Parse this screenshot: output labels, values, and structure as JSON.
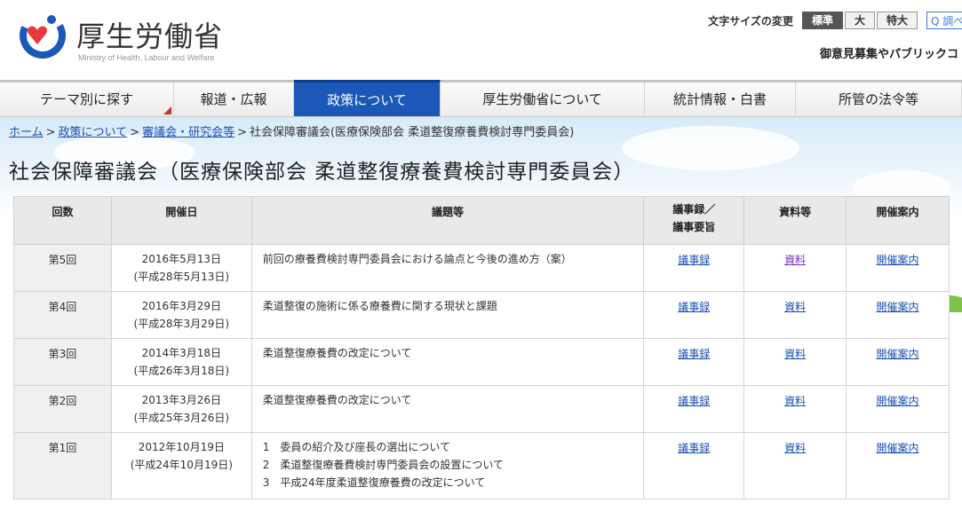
{
  "header": {
    "org_name": "厚生労働省",
    "org_name_en": "Ministry of Health, Labour and Welfare",
    "font_size_label": "文字サイズの変更",
    "font_sizes": [
      "標準",
      "大",
      "特大"
    ],
    "search_text": "Q 調べ",
    "public_comment_link": "御意見募集やパブリックコ"
  },
  "nav": {
    "items": [
      "テーマ別に探す",
      "報道・広報",
      "政策について",
      "厚生労働省について",
      "統計情報・白書",
      "所管の法令等"
    ]
  },
  "breadcrumb": {
    "home": "ホーム",
    "policy": "政策について",
    "councils": "審議会・研究会等",
    "current": "社会保障審議会(医療保険部会 柔道整復療養費検討専門委員会)"
  },
  "page_title": "社会保障審議会（医療保険部会 柔道整復療養費検討専門委員会）",
  "table": {
    "headers": {
      "num": "回数",
      "date": "開催日",
      "topic": "議題等",
      "minutes_1": "議事録／",
      "minutes_2": "議事要旨",
      "materials": "資料等",
      "notice": "開催案内"
    },
    "rows": [
      {
        "num": "第5回",
        "date": "2016年5月13日",
        "date_jp": "(平成28年5月13日)",
        "topics": [
          "前回の療養費検討専門委員会における論点と今後の進め方（案）"
        ],
        "minutes": "議事録",
        "materials": "資料",
        "notice": "開催案内"
      },
      {
        "num": "第4回",
        "date": "2016年3月29日",
        "date_jp": "(平成28年3月29日)",
        "topics": [
          "柔道整復の施術に係る療養費に関する現状と課題"
        ],
        "minutes": "議事録",
        "materials": "資料",
        "notice": "開催案内"
      },
      {
        "num": "第3回",
        "date": "2014年3月18日",
        "date_jp": "(平成26年3月18日)",
        "topics": [
          "柔道整復療養費の改定について"
        ],
        "minutes": "議事録",
        "materials": "資料",
        "notice": "開催案内"
      },
      {
        "num": "第2回",
        "date": "2013年3月26日",
        "date_jp": "(平成25年3月26日)",
        "topics": [
          "柔道整復療養費の改定について"
        ],
        "minutes": "議事録",
        "materials": "資料",
        "notice": "開催案内"
      },
      {
        "num": "第1回",
        "date": "2012年10月19日",
        "date_jp": "(平成24年10月19日)",
        "topics": [
          "1　委員の紹介及び座長の選出について",
          "2　柔道整復療養費検討専門委員会の設置について",
          "3　平成24年度柔道整復療養費の改定について"
        ],
        "minutes": "議事録",
        "materials": "資料",
        "notice": "開催案内"
      }
    ]
  },
  "colors": {
    "nav_active": "#1b58b8",
    "link": "#1a4fb5",
    "link_visited": "#7a33b5",
    "logo_red": "#e8383d",
    "logo_blue": "#1b58b8"
  }
}
